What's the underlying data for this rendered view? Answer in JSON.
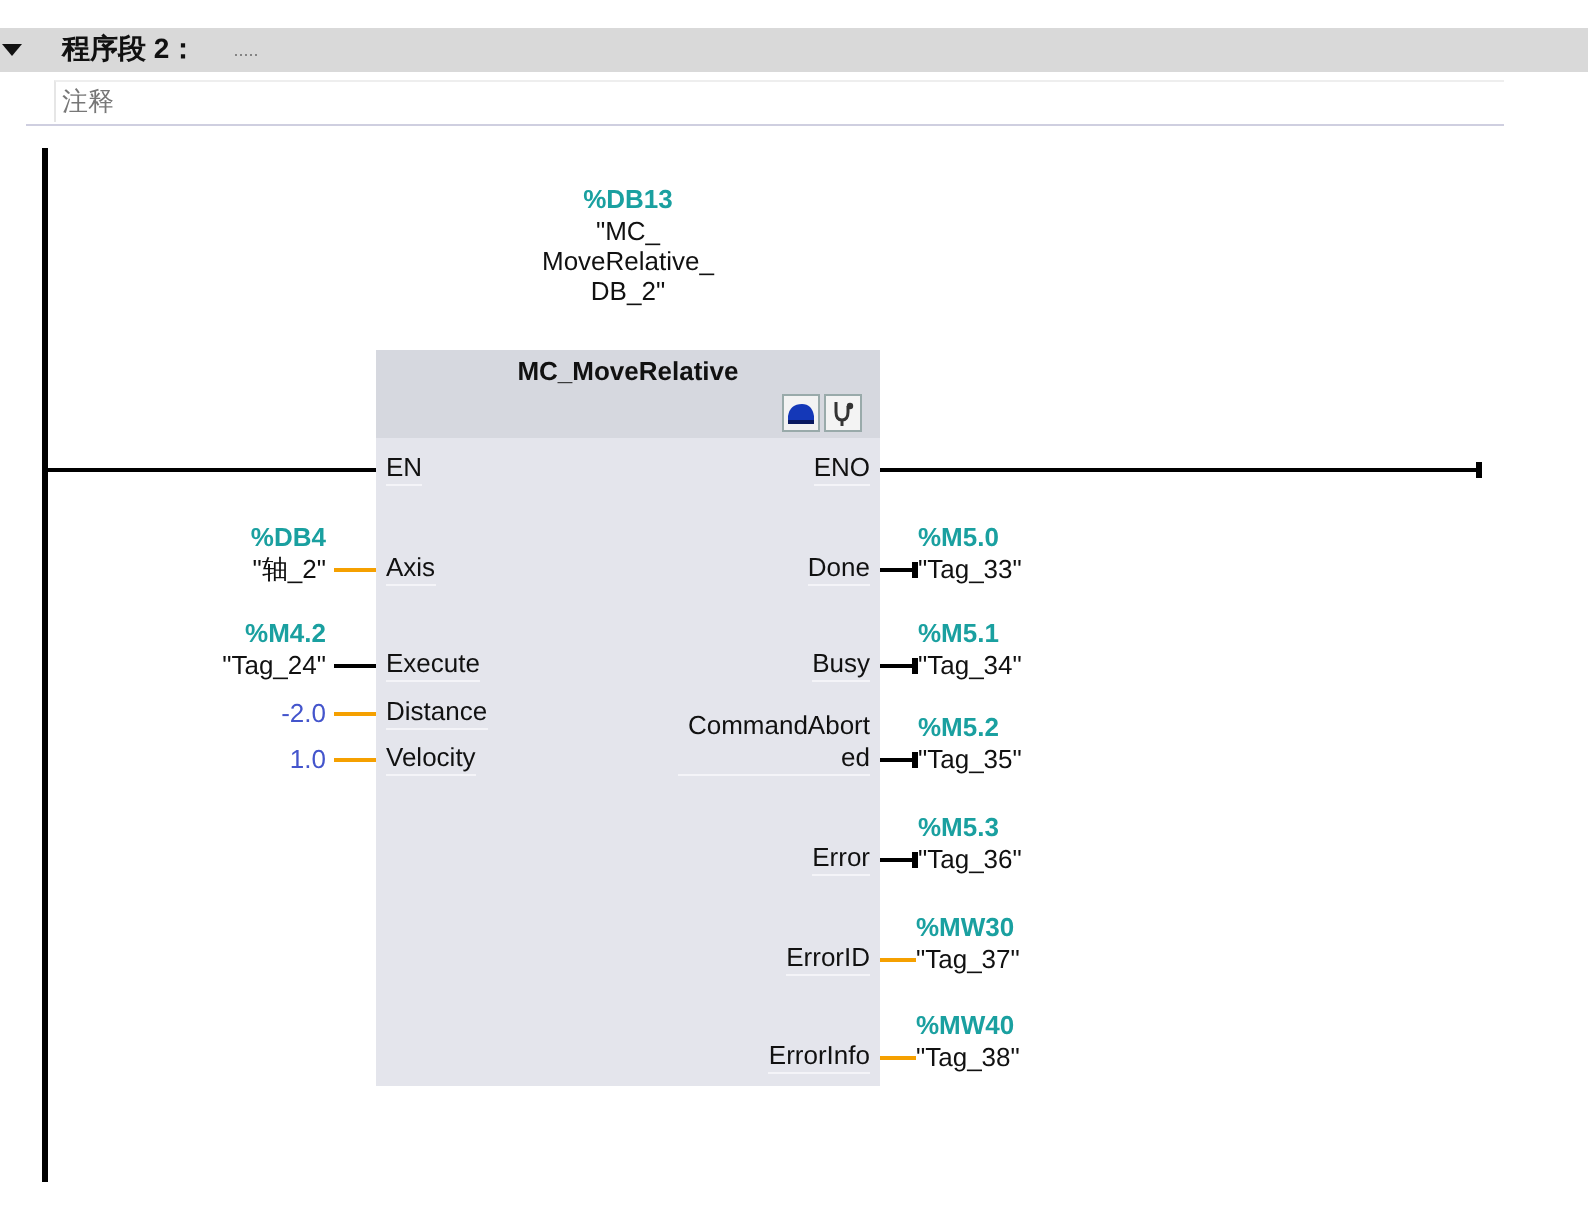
{
  "network": {
    "expanded": true,
    "title": "程序段 2：",
    "title_comment": ".....",
    "comment": "注释"
  },
  "block": {
    "instance": {
      "address": "%DB13",
      "name_lines": [
        "\"MC_",
        "MoveRelative_",
        "DB_2\""
      ]
    },
    "type": "MC_MoveRelative",
    "inputs": [
      {
        "pin": "EN",
        "kind": "power"
      },
      {
        "pin": "Axis",
        "kind": "value",
        "operand": {
          "kind": "tag",
          "address": "%DB4",
          "text": "\"轴_2\""
        }
      },
      {
        "pin": "Execute",
        "kind": "bool",
        "operand": {
          "kind": "tag",
          "address": "%M4.2",
          "text": "\"Tag_24\""
        }
      },
      {
        "pin": "Distance",
        "kind": "value",
        "operand": {
          "kind": "constant",
          "text": "-2.0"
        }
      },
      {
        "pin": "Velocity",
        "kind": "value",
        "operand": {
          "kind": "constant",
          "text": "1.0"
        }
      }
    ],
    "outputs": [
      {
        "pin": "ENO",
        "kind": "power"
      },
      {
        "pin": "Done",
        "kind": "bool",
        "operand": {
          "kind": "tag",
          "address": "%M5.0",
          "text": "\"Tag_33\""
        }
      },
      {
        "pin": "Busy",
        "kind": "bool",
        "operand": {
          "kind": "tag",
          "address": "%M5.1",
          "text": "\"Tag_34\""
        }
      },
      {
        "pin": "CommandAborted",
        "kind": "bool",
        "operand": {
          "kind": "tag",
          "address": "%M5.2",
          "text": "\"Tag_35\""
        }
      },
      {
        "pin": "Error",
        "kind": "bool",
        "operand": {
          "kind": "tag",
          "address": "%M5.3",
          "text": "\"Tag_36\""
        }
      },
      {
        "pin": "ErrorID",
        "kind": "value",
        "operand": {
          "kind": "tag",
          "address": "%MW30",
          "text": "\"Tag_37\""
        }
      },
      {
        "pin": "ErrorInfo",
        "kind": "value",
        "operand": {
          "kind": "tag",
          "address": "%MW40",
          "text": "\"Tag_38\""
        }
      }
    ]
  }
}
